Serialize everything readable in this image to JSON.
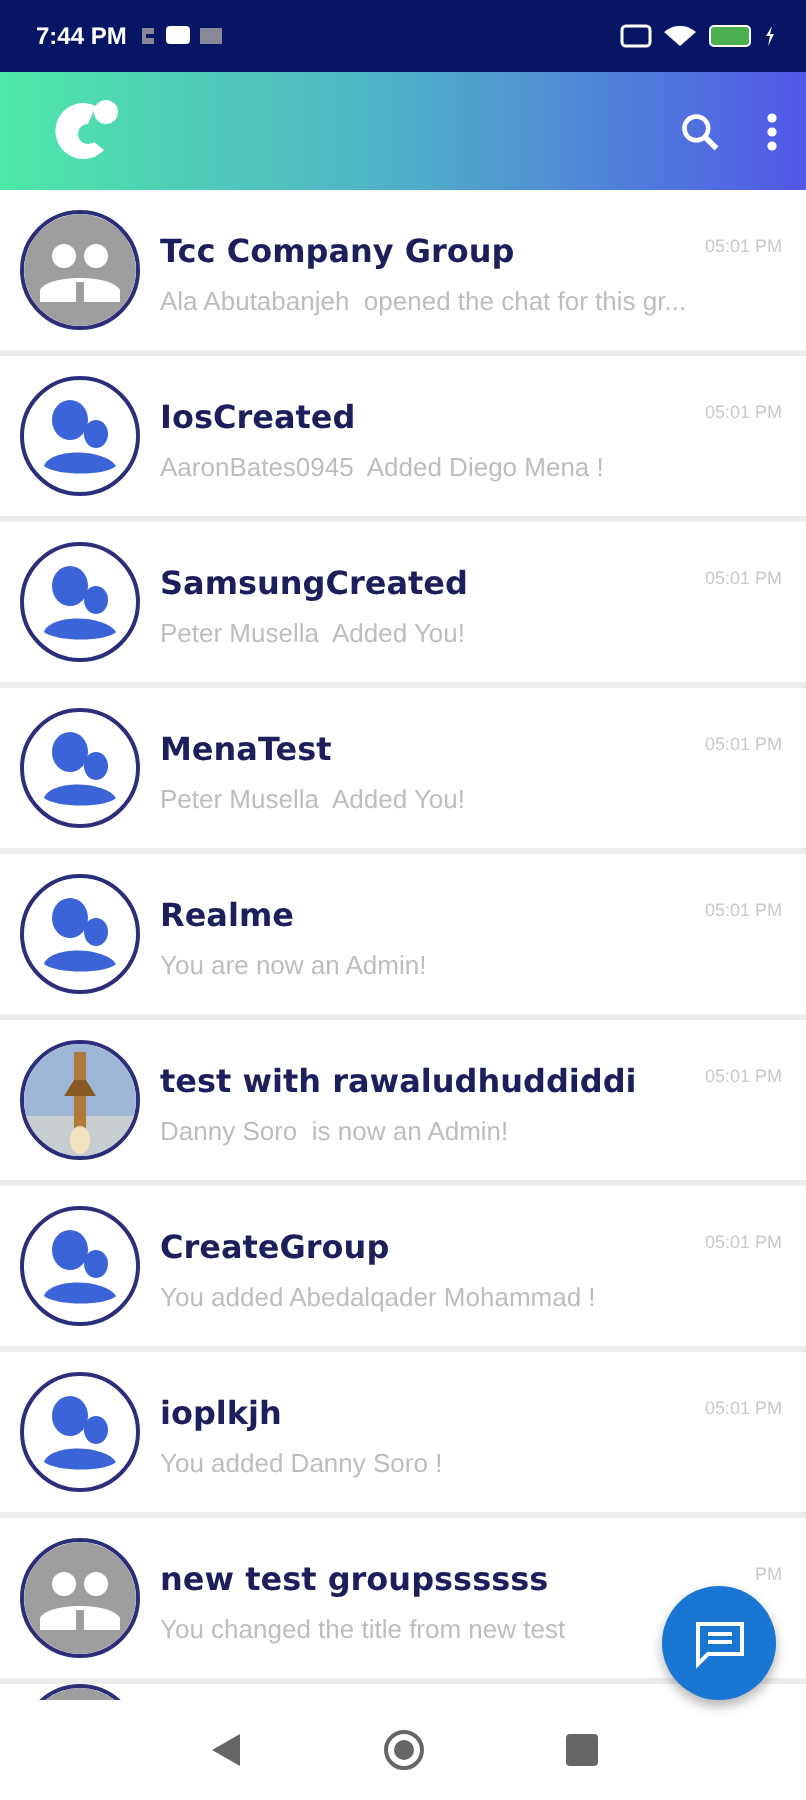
{
  "status_bar": {
    "time": "7:44 PM"
  },
  "chats": [
    {
      "kind": "gray",
      "name": "Tcc Company Group",
      "preview": "Ala Abutabanjeh  opened the chat for this gr...",
      "time": "05:01 PM"
    },
    {
      "kind": "group",
      "name": "IosCreated",
      "preview": "AaronBates0945  Added Diego Mena !",
      "time": "05:01 PM"
    },
    {
      "kind": "group",
      "name": "SamsungCreated",
      "preview": "Peter Musella  Added You!",
      "time": "05:01 PM"
    },
    {
      "kind": "group",
      "name": "MenaTest",
      "preview": "Peter Musella  Added You!",
      "time": "05:01 PM"
    },
    {
      "kind": "group",
      "name": "Realme",
      "preview": "You are now an Admin!",
      "time": "05:01 PM"
    },
    {
      "kind": "picture",
      "name": "test with rawaludhuddiddi",
      "preview": "Danny Soro  is now an Admin!",
      "time": "05:01 PM"
    },
    {
      "kind": "group",
      "name": "CreateGroup",
      "preview": "You added Abedalqader Mohammad !",
      "time": "05:01 PM"
    },
    {
      "kind": "group",
      "name": "ioplkjh",
      "preview": "You added Danny Soro !",
      "time": "05:01 PM"
    },
    {
      "kind": "gray",
      "name": "new test groupssssss",
      "preview": "You changed the title from new test",
      "time": "PM"
    }
  ],
  "partial_row": {
    "kind": "gray"
  }
}
